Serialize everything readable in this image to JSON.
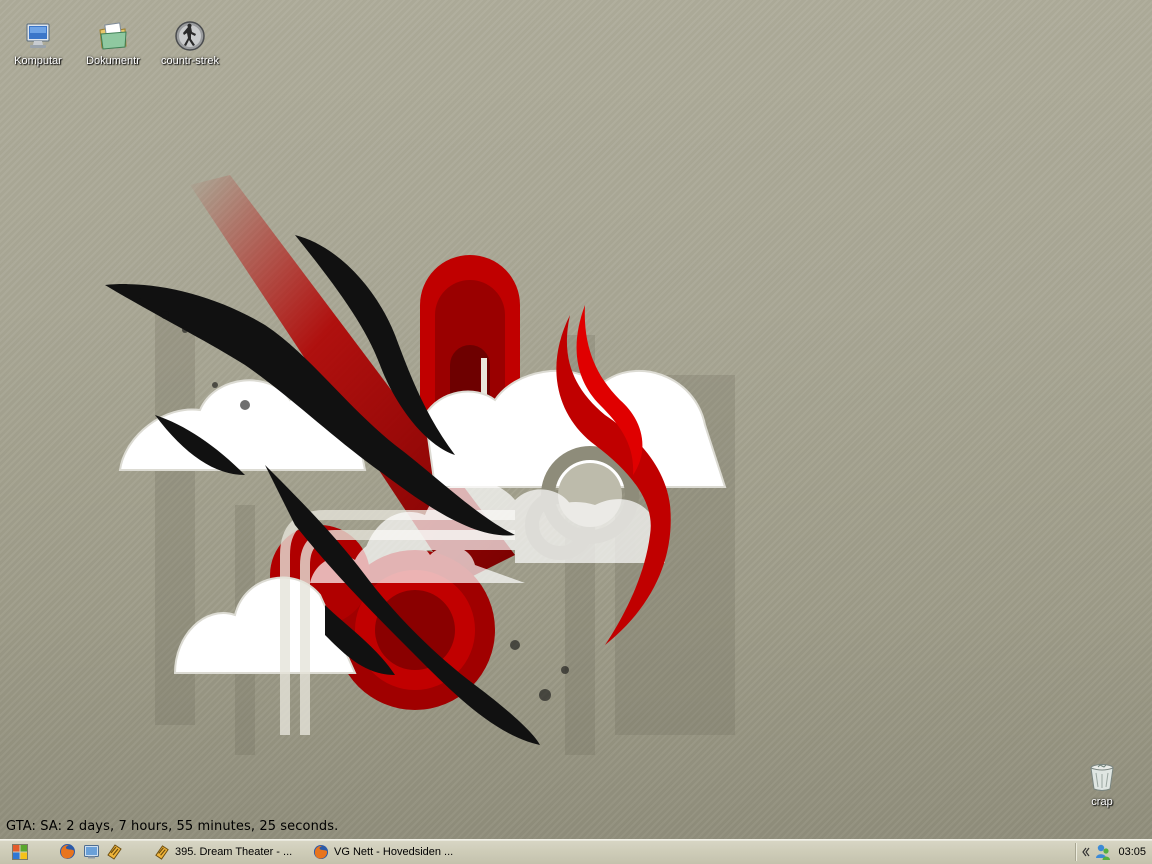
{
  "desktop": {
    "icons": [
      {
        "label": "Komputar",
        "icon": "computer-icon"
      },
      {
        "label": "Dokumentr",
        "icon": "documents-icon"
      },
      {
        "label": "countr-strek",
        "icon": "counter-strike-icon"
      },
      {
        "label": "crap",
        "icon": "recycle-bin-icon"
      }
    ],
    "uptime_text": "GTA: SA: 2 days, 7 hours, 55 minutes, 25 seconds."
  },
  "taskbar": {
    "start_icon": "windows-logo-icon",
    "quicklaunch": [
      {
        "icon": "firefox-icon"
      },
      {
        "icon": "show-desktop-icon"
      },
      {
        "icon": "winamp-icon"
      }
    ],
    "tasks": [
      {
        "label": "395. Dream Theater - ...",
        "icon": "winamp-icon"
      },
      {
        "label": "VG Nett - Hovedsiden ...",
        "icon": "firefox-icon"
      }
    ],
    "tray": {
      "collapse_icon": "tray-collapse-icon",
      "network_icon": "messenger-icon",
      "clock": "03:05"
    }
  },
  "colors": {
    "desktop_bg": "#a9a795",
    "taskbar_bg": "#cfcdb9",
    "wallpaper_red": "#c00000"
  }
}
